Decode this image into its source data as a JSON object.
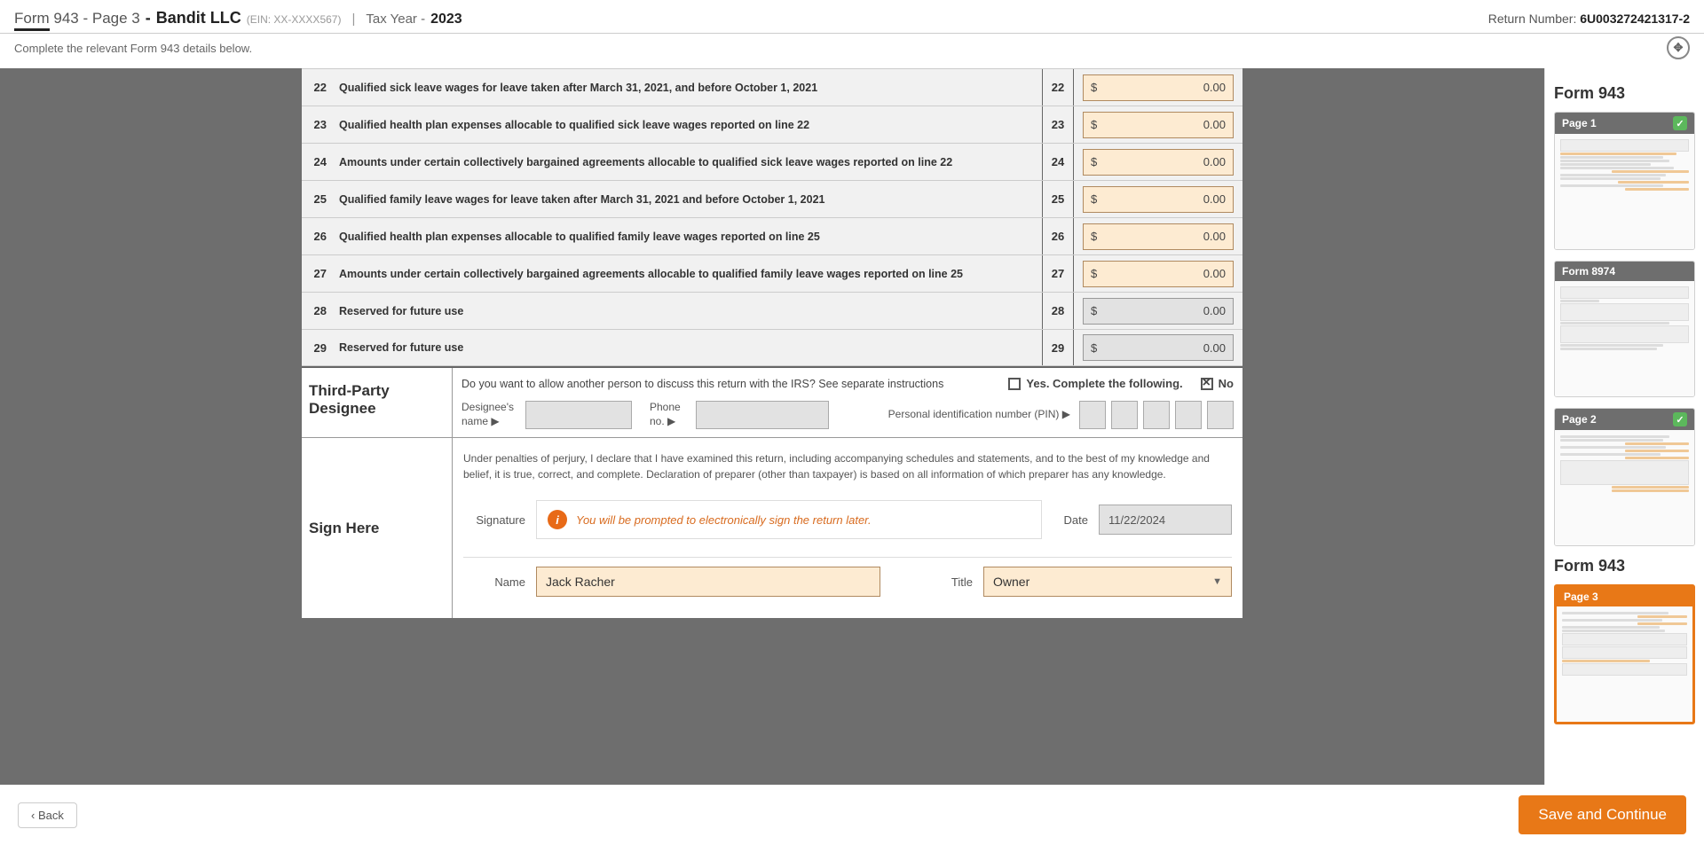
{
  "header": {
    "form_title": "Form 943 - Page 3",
    "dash": " - ",
    "company": "Bandit LLC",
    "ein": "(EIN: XX-XXXX567)",
    "sep": "|",
    "taxyear_label": "Tax Year - ",
    "taxyear": "2023",
    "return_label": "Return Number: ",
    "return_number": "6U003272421317-2"
  },
  "subheader": "Complete the relevant Form 943 details below.",
  "lines": [
    {
      "num": "22",
      "label": "Qualified sick leave wages for leave taken after March 31, 2021, and before October 1, 2021",
      "num2": "22",
      "amount": "0.00",
      "gray": false
    },
    {
      "num": "23",
      "label": "Qualified health plan expenses allocable to qualified sick leave wages reported on line 22",
      "num2": "23",
      "amount": "0.00",
      "gray": false
    },
    {
      "num": "24",
      "label": "Amounts under certain collectively bargained agreements allocable to qualified sick leave wages reported on line 22",
      "num2": "24",
      "amount": "0.00",
      "gray": false
    },
    {
      "num": "25",
      "label": "Qualified family leave wages for leave taken after March 31, 2021 and before October 1, 2021",
      "num2": "25",
      "amount": "0.00",
      "gray": false
    },
    {
      "num": "26",
      "label": "Qualified health plan expenses allocable to qualified family leave wages reported on line 25",
      "num2": "26",
      "amount": "0.00",
      "gray": false
    },
    {
      "num": "27",
      "label": "Amounts under certain collectively bargained agreements allocable to qualified family leave wages reported on line 25",
      "num2": "27",
      "amount": "0.00",
      "gray": false
    },
    {
      "num": "28",
      "label": "Reserved for future use",
      "num2": "28",
      "amount": "0.00",
      "gray": true
    },
    {
      "num": "29",
      "label": "Reserved for future use",
      "num2": "29",
      "amount": "0.00",
      "gray": true
    }
  ],
  "designee": {
    "title": "Third-Party Designee",
    "question": "Do you want to allow another person to discuss this return with the IRS? See separate instructions",
    "yes": "Yes. Complete the following.",
    "no": "No",
    "name_label": "Designee's name ▶",
    "phone_label": "Phone no. ▶",
    "pin_label": "Personal identification number (PIN) ▶"
  },
  "sign": {
    "title": "Sign Here",
    "perjury": "Under penalties of perjury, I declare that I have examined this return, including accompanying schedules and statements, and to the best of my knowledge and belief, it is true, correct, and complete. Declaration of preparer (other than taxpayer) is based on all information of which preparer has any knowledge.",
    "signature_label": "Signature",
    "sig_note": "You will be prompted to electronically sign the return later.",
    "date_label": "Date",
    "date_value": "11/22/2024",
    "name_label": "Name",
    "name_value": "Jack Racher",
    "title_label": "Title",
    "title_value": "Owner"
  },
  "sidebar": {
    "form943": "Form 943",
    "page1": "Page 1",
    "form8974": "Form 8974",
    "page2": "Page 2",
    "page3": "Page 3"
  },
  "footer": {
    "back": "Back",
    "save": "Save and Continue"
  }
}
